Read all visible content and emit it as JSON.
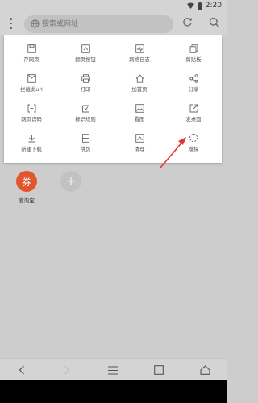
{
  "status": {
    "time": "2:20"
  },
  "toolbar": {
    "search_placeholder": "搜索或网址"
  },
  "menu": {
    "items": [
      {
        "label": "存网页",
        "icon": "save-page-icon"
      },
      {
        "label": "翻页按钮",
        "icon": "page-button-icon"
      },
      {
        "label": "网络日志",
        "icon": "network-log-icon"
      },
      {
        "label": "剪贴板",
        "icon": "clipboard-icon"
      },
      {
        "label": "拦截此url",
        "icon": "block-url-icon"
      },
      {
        "label": "打印",
        "icon": "print-icon"
      },
      {
        "label": "加首页",
        "icon": "add-home-icon"
      },
      {
        "label": "分享",
        "icon": "share-icon"
      },
      {
        "label": "网页识码",
        "icon": "page-code-icon"
      },
      {
        "label": "标识规则",
        "icon": "mark-rule-icon"
      },
      {
        "label": "看图",
        "icon": "view-image-icon"
      },
      {
        "label": "发桌面",
        "icon": "send-desktop-icon"
      },
      {
        "label": "新建下载",
        "icon": "new-download-icon"
      },
      {
        "label": "拼页",
        "icon": "merge-page-icon"
      },
      {
        "label": "清理",
        "icon": "clean-icon"
      },
      {
        "label": "嗅探",
        "icon": "sniff-icon"
      }
    ]
  },
  "shortcuts": [
    {
      "label": "爱淘宝",
      "glyph": "券"
    },
    {
      "label": "",
      "glyph": "+"
    }
  ],
  "colors": {
    "accent_red": "#e3552d",
    "arrow_red": "#e5362c"
  }
}
